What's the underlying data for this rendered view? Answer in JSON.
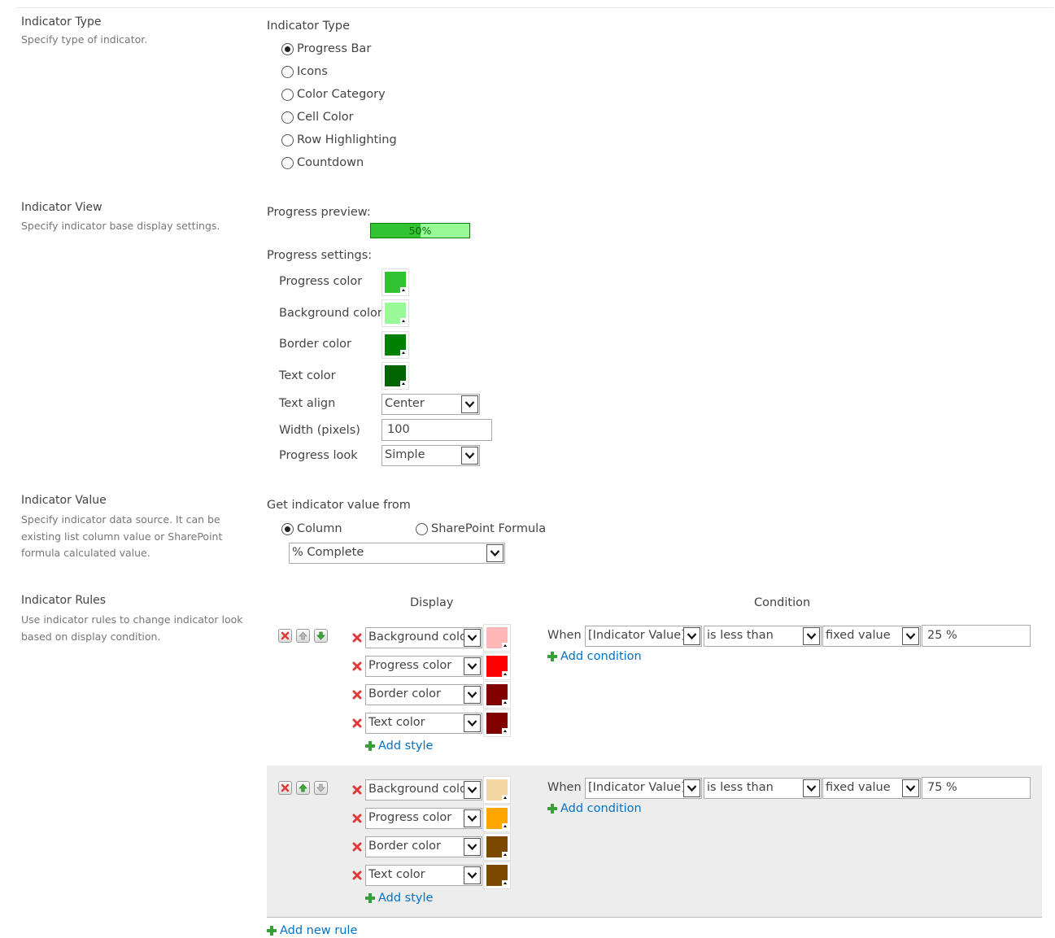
{
  "sections": {
    "type": {
      "title": "Indicator Type",
      "desc": "Specify type of indicator."
    },
    "view": {
      "title": "Indicator View",
      "desc": "Specify indicator base display settings."
    },
    "value": {
      "title": "Indicator Value",
      "desc": "Specify indicator data source. It can be existing list column value or SharePoint formula calculated value."
    },
    "rules": {
      "title": "Indicator Rules",
      "desc": "Use indicator rules to change indicator look based on display condition."
    }
  },
  "indicator_type": {
    "label": "Indicator Type",
    "selected": "Progress Bar",
    "options": [
      "Progress Bar",
      "Icons",
      "Color Category",
      "Cell Color",
      "Row Highlighting",
      "Countdown"
    ]
  },
  "view": {
    "preview_label": "Progress preview:",
    "preview_text": "50%",
    "preview_fraction": 0.5,
    "settings_label": "Progress settings:",
    "progress_color_label": "Progress color",
    "progress_color": "#32c332",
    "background_color_label": "Background color",
    "background_color": "#98fb98",
    "border_color_label": "Border color",
    "border_color": "#008000",
    "text_color_label": "Text color",
    "text_color": "#006400",
    "text_align_label": "Text align",
    "text_align": "Center",
    "width_label": "Width (pixels)",
    "width": "100",
    "look_label": "Progress look",
    "look": "Simple"
  },
  "value_source": {
    "label": "Get indicator value from",
    "option_column": "Column",
    "option_formula": "SharePoint Formula",
    "selected": "Column",
    "column": "% Complete"
  },
  "rules": {
    "display_header": "Display",
    "condition_header": "Condition",
    "add_style": "Add style",
    "add_condition": "Add condition",
    "add_new_rule": "Add new rule",
    "items": [
      {
        "styles": [
          {
            "property": "Background color",
            "color": "#ffb6b6"
          },
          {
            "property": "Progress color",
            "color": "#ff0000"
          },
          {
            "property": "Border color",
            "color": "#800000"
          },
          {
            "property": "Text color",
            "color": "#800000"
          }
        ],
        "condition": {
          "when": "When",
          "field": "[Indicator Value]",
          "operator": "is less than",
          "source": "fixed value",
          "value": "25 %"
        }
      },
      {
        "styles": [
          {
            "property": "Background color",
            "color": "#f5d7a1"
          },
          {
            "property": "Progress color",
            "color": "#ffa500"
          },
          {
            "property": "Border color",
            "color": "#7b4a00"
          },
          {
            "property": "Text color",
            "color": "#7b4a00"
          }
        ],
        "condition": {
          "when": "When",
          "field": "[Indicator Value]",
          "operator": "is less than",
          "source": "fixed value",
          "value": "75 %"
        }
      }
    ]
  }
}
